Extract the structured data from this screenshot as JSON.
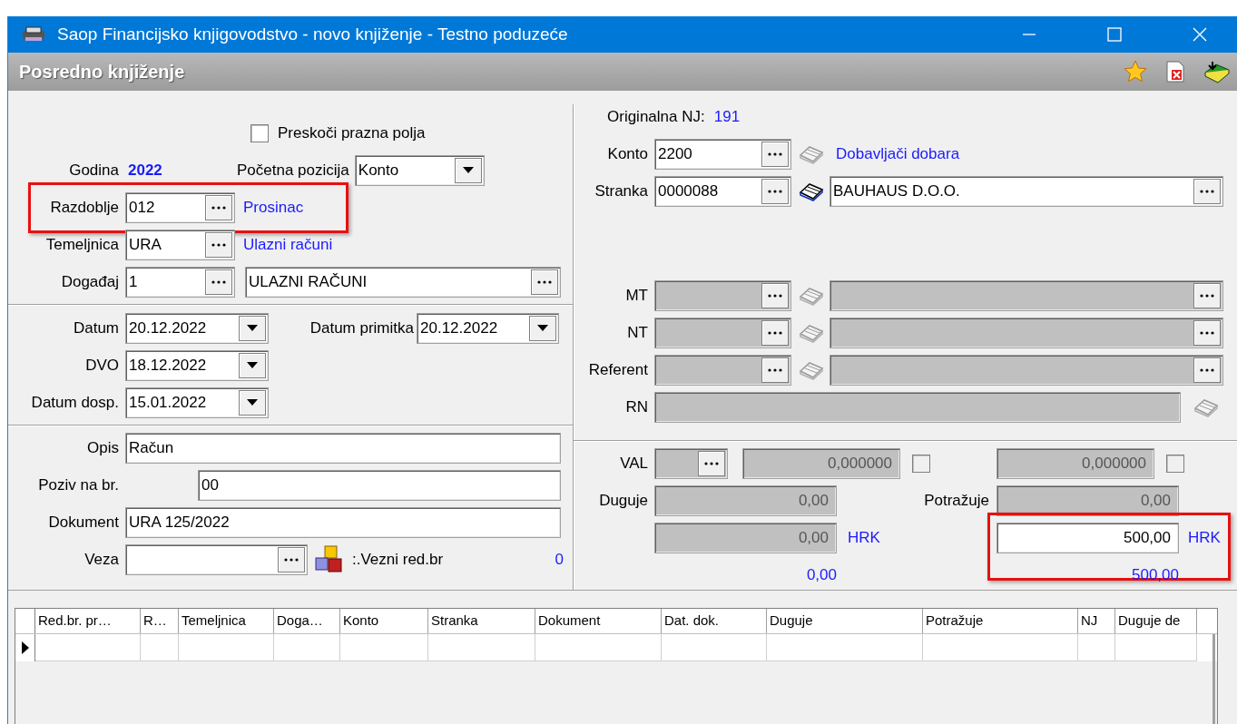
{
  "window": {
    "title": "Saop Financijsko knjigovodstvo - novo knjiženje - Testno poduzeće"
  },
  "header": {
    "title": "Posredno knjiženje"
  },
  "left": {
    "skip_empty": {
      "label": "Preskoči prazna polja",
      "checked": false
    },
    "year": {
      "label": "Godina",
      "value": "2022"
    },
    "start_position": {
      "label": "Početna pozicija",
      "value": "Konto"
    },
    "period": {
      "label": "Razdoblje",
      "value": "012",
      "description": "Prosinac",
      "highlighted": true
    },
    "journal": {
      "label": "Temeljnica",
      "value": "URA",
      "description": "Ulazni računi"
    },
    "event": {
      "label": "Događaj",
      "value": "1",
      "description": "ULAZNI RAČUNI"
    },
    "date": {
      "label": "Datum",
      "value": "20.12.2022"
    },
    "receipt_date": {
      "label": "Datum primitka",
      "value": "20.12.2022"
    },
    "dvo": {
      "label": "DVO",
      "value": "18.12.2022"
    },
    "due_date": {
      "label": "Datum dosp.",
      "value": "15.01.2022"
    },
    "description": {
      "label": "Opis",
      "value": "Račun"
    },
    "reference": {
      "label": "Poziv na br.",
      "value": "00"
    },
    "document": {
      "label": "Dokument",
      "value": "URA 125/2022"
    },
    "link": {
      "label": "Veza"
    },
    "link_row": {
      "label": ":.Vezni red.br",
      "value": "0"
    }
  },
  "right": {
    "original_nj": {
      "label": "Originalna NJ:",
      "value": "191"
    },
    "account": {
      "label": "Konto",
      "value": "2200",
      "description": "Dobavljači dobara",
      "linked": false
    },
    "partner": {
      "label": "Stranka",
      "value": "0000088",
      "name": "BAUHAUS D.O.O.",
      "linked": true
    },
    "lookups": [
      {
        "label": "MT",
        "disabled": true
      },
      {
        "label": "NT",
        "disabled": true
      },
      {
        "label": "Referent",
        "disabled": true
      }
    ],
    "rn": {
      "label": "RN",
      "disabled": true
    },
    "currency": {
      "label": "VAL",
      "disabled": true,
      "debit_rate": "0,000000",
      "debit_rate_checked": false,
      "credit_rate": "0,000000",
      "credit_rate_checked": false
    },
    "debit": {
      "label": "Duguje",
      "value": "0,00",
      "disabled": true
    },
    "credit": {
      "label": "Potražuje",
      "value": "0,00",
      "disabled": true
    },
    "debit_home": {
      "value": "0,00",
      "currency": "HRK",
      "disabled": true
    },
    "credit_home": {
      "value": "500,00",
      "currency": "HRK",
      "disabled": false,
      "highlighted": true
    },
    "debit_total": "0,00",
    "credit_total": "500,00"
  },
  "grid": {
    "columns": [
      "Red.br. pr…",
      "R…",
      "Temeljnica",
      "Doga…",
      "Konto",
      "Stranka",
      "Dokument",
      "Dat. dok.",
      "Duguje",
      "Potražuje",
      "NJ",
      "Duguje de"
    ],
    "rows": [
      {
        "current": true
      }
    ]
  }
}
